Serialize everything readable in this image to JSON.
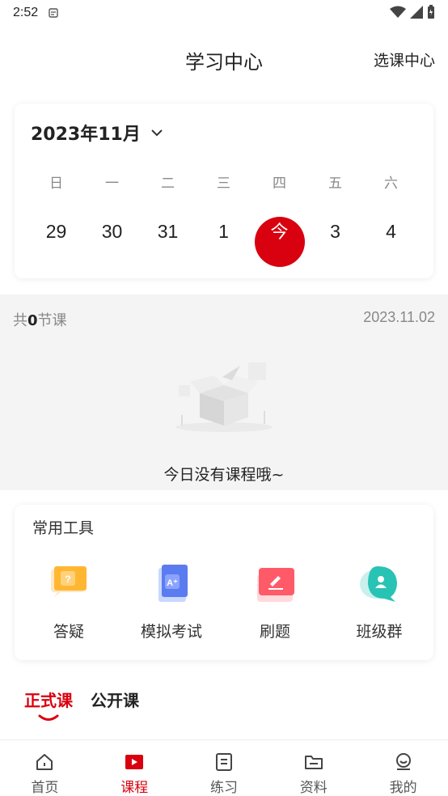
{
  "status_bar": {
    "time": "2:52"
  },
  "header": {
    "title": "学习中心",
    "right_link": "选课中心"
  },
  "calendar": {
    "month": "2023年11月",
    "weekdays": [
      "日",
      "一",
      "二",
      "三",
      "四",
      "五",
      "六"
    ],
    "dates": [
      "29",
      "30",
      "31",
      "1",
      "今",
      "3",
      "4"
    ],
    "selected_index": 4,
    "accent_color": "#d9000f"
  },
  "lessons": {
    "count_prefix": "共",
    "count": "0",
    "count_suffix": "节课",
    "date": "2023.11.02",
    "empty_text": "今日没有课程哦~"
  },
  "tools": {
    "title": "常用工具",
    "items": [
      {
        "label": "答疑",
        "icon": "qa-bubble-icon"
      },
      {
        "label": "模拟考试",
        "icon": "mock-exam-icon"
      },
      {
        "label": "刷题",
        "icon": "practice-icon"
      },
      {
        "label": "班级群",
        "icon": "class-group-icon"
      }
    ]
  },
  "course_tabs": [
    {
      "label": "正式课",
      "active": true
    },
    {
      "label": "公开课",
      "active": false
    }
  ],
  "bottom_nav": [
    {
      "label": "首页",
      "icon": "home-icon",
      "active": false
    },
    {
      "label": "课程",
      "icon": "course-play-icon",
      "active": true
    },
    {
      "label": "练习",
      "icon": "practice-doc-icon",
      "active": false
    },
    {
      "label": "资料",
      "icon": "folder-icon",
      "active": false
    },
    {
      "label": "我的",
      "icon": "profile-icon",
      "active": false
    }
  ]
}
